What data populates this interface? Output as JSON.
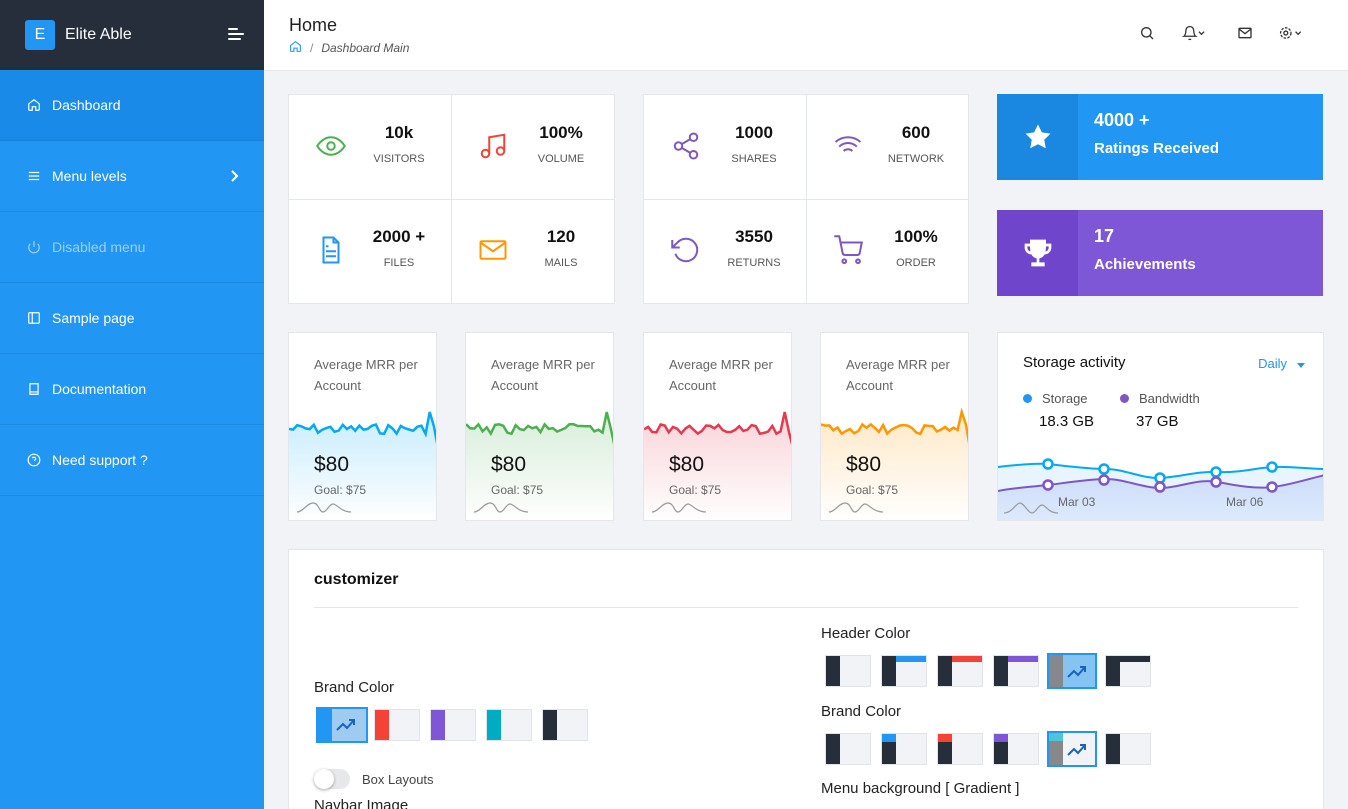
{
  "brand": {
    "logo_letter": "E",
    "name": "Elite Able"
  },
  "sidebar": {
    "items": [
      {
        "label": "Dashboard",
        "icon": "home-icon"
      },
      {
        "label": "Menu levels",
        "icon": "menu-icon"
      },
      {
        "label": "Disabled menu",
        "icon": "power-icon"
      },
      {
        "label": "Sample page",
        "icon": "sidebar-icon"
      },
      {
        "label": "Documentation",
        "icon": "book-icon"
      },
      {
        "label": "Need support ?",
        "icon": "help-circle-icon"
      }
    ]
  },
  "header": {
    "title": "Home",
    "breadcrumb": {
      "separator": "/",
      "current": "Dashboard Main"
    }
  },
  "stats_left": [
    {
      "value": "10k",
      "label": "VISITORS",
      "icon": "eye-icon",
      "color": "#4caf50"
    },
    {
      "value": "100%",
      "label": "VOLUME",
      "icon": "music-icon",
      "color": "#f44336"
    },
    {
      "value": "2000 +",
      "label": "FILES",
      "icon": "file-text-icon",
      "color": "#2196f3"
    },
    {
      "value": "120",
      "label": "MAILS",
      "icon": "mail-icon",
      "color": "#ff9800"
    }
  ],
  "stats_right": [
    {
      "value": "1000",
      "label": "SHARES",
      "icon": "share-icon",
      "color": "#7e57c2"
    },
    {
      "value": "600",
      "label": "NETWORK",
      "icon": "wifi-icon",
      "color": "#7e57c2"
    },
    {
      "value": "3550",
      "label": "RETURNS",
      "icon": "rotate-icon",
      "color": "#7e57c2"
    },
    {
      "value": "100%",
      "label": "ORDER",
      "icon": "cart-icon",
      "color": "#7e57c2"
    }
  ],
  "highlights": [
    {
      "value": "4000 +",
      "label": "Ratings Received",
      "icon": "star-icon",
      "color": "#2196f3"
    },
    {
      "value": "17",
      "label": "Achievements",
      "icon": "trophy-icon",
      "color": "#7e57d6"
    }
  ],
  "mrr_cards": [
    {
      "title": "Average MRR per Account",
      "value": "$80",
      "goal": "Goal: $75",
      "color": "#03a9f4"
    },
    {
      "title": "Average MRR per Account",
      "value": "$80",
      "goal": "Goal: $75",
      "color": "#4caf50"
    },
    {
      "title": "Average MRR per Account",
      "value": "$80",
      "goal": "Goal: $75",
      "color": "#e53950"
    },
    {
      "title": "Average MRR per Account",
      "value": "$80",
      "goal": "Goal: $75",
      "color": "#ff9800"
    }
  ],
  "storage": {
    "title": "Storage activity",
    "period": "Daily",
    "legend": [
      {
        "name": "Storage",
        "value": "18.3 GB",
        "color": "#2196f3"
      },
      {
        "name": "Bandwidth",
        "value": "37 GB",
        "color": "#7e57c2"
      }
    ],
    "x_labels": [
      "Mar 03",
      "Mar 06"
    ]
  },
  "customizer": {
    "title": "customizer",
    "brand_color_label": "Brand Color",
    "box_layouts_label": "Box Layouts",
    "navbar_image_label": "Navbar Image",
    "header_color_label": "Header Color",
    "brand_color_label_2": "Brand Color",
    "menu_bg_label": "Menu background [ Gradient ]"
  }
}
